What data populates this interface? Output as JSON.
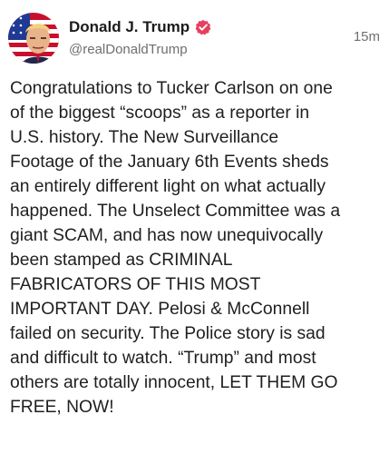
{
  "post": {
    "author": {
      "display_name": "Donald J. Trump",
      "handle": "@realDonaldTrump",
      "verified_icon": "verified-badge-icon",
      "verified_color": "#e4405f",
      "avatar": "user-avatar"
    },
    "timestamp": "15m",
    "body": "Congratulations to Tucker Carlson on one\nof the biggest “scoops” as a reporter in\nU.S. history. The New Surveillance\nFootage of the January 6th Events sheds\nan entirely different light on what actually\nhappened. The Unselect Committee was a\ngiant SCAM, and has now unequivocally\nbeen stamped as CRIMINAL\nFABRICATORS OF THIS MOST\nIMPORTANT DAY. Pelosi & McConnell\nfailed on security. The Police story is sad\nand difficult to watch. “Trump” and most\nothers are totally innocent, LET THEM GO\nFREE, NOW!"
  }
}
